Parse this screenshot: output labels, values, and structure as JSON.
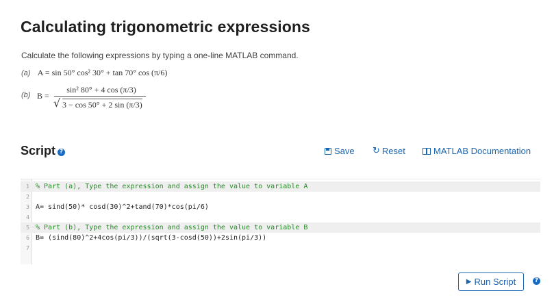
{
  "page": {
    "title": "Calculating trigonometric expressions",
    "intro": "Calculate the following expressions by typing a one-line MATLAB command."
  },
  "expressions": {
    "a_label": "(a)",
    "a_text": "A = sin 50° cos² 30° + tan 70° cos (π/6)",
    "b_label": "(b)",
    "b_var": "B =",
    "b_numerator": "sin² 80° + 4 cos (π/3)",
    "b_denominator": "3 − cos 50° + 2 sin (π/3)"
  },
  "script": {
    "heading": "Script",
    "save_label": "Save",
    "reset_label": "Reset",
    "docs_label": "MATLAB Documentation",
    "lines": [
      {
        "num": "1",
        "text": "% Part (a), Type the expression and assign the value to variable A",
        "comment": true
      },
      {
        "num": "2",
        "text": "",
        "comment": false
      },
      {
        "num": "3",
        "text": "A= sind(50)* cosd(30)^2+tand(70)*cos(pi/6)",
        "comment": false
      },
      {
        "num": "4",
        "text": "",
        "comment": false
      },
      {
        "num": "5",
        "text": "% Part (b), Type the expression and assign the value to variable B",
        "comment": true
      },
      {
        "num": "6",
        "text": "B= (sind(80)^2+4cos(pi/3))/(sqrt(3-cosd(50))+2sin(pi/3))",
        "comment": false
      },
      {
        "num": "7",
        "text": "",
        "comment": false
      }
    ],
    "run_label": "Run Script"
  },
  "icons": {
    "help": "help-icon",
    "save": "save-icon",
    "reset": "reset-icon",
    "docs": "documentation-icon",
    "run": "play-icon"
  },
  "colors": {
    "link": "#1a64b0",
    "comment": "#228b22",
    "help_badge": "#1a6bc4"
  }
}
